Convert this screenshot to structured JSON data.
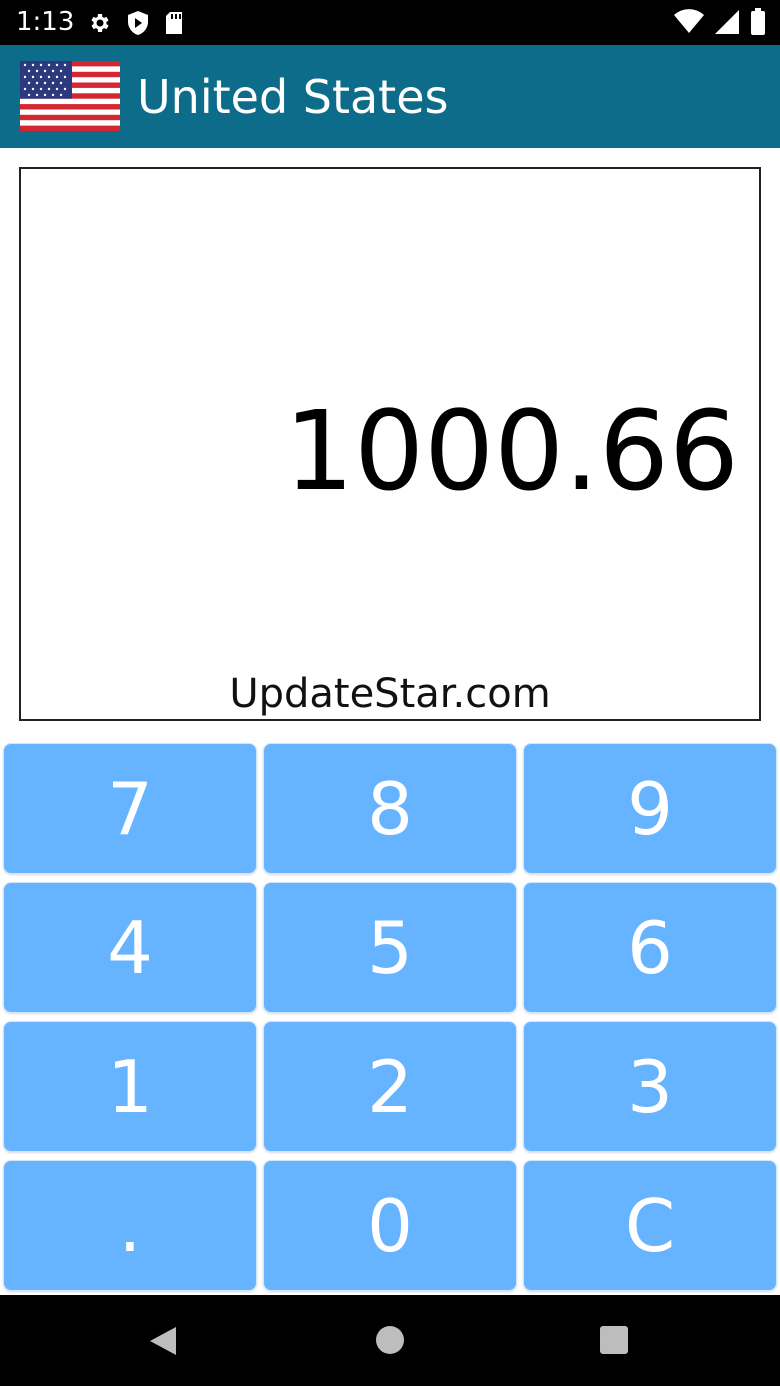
{
  "status_bar": {
    "time": "1:13",
    "left_icons": [
      "gear-icon",
      "shield-play-icon",
      "sd-card-icon"
    ],
    "right_icons": [
      "wifi-icon",
      "signal-icon",
      "battery-icon"
    ]
  },
  "app_bar": {
    "title": "United States",
    "flag": "us-flag-icon"
  },
  "display": {
    "value": "1000.66",
    "watermark": "UpdateStar.com"
  },
  "keypad": {
    "keys": [
      "7",
      "8",
      "9",
      "4",
      "5",
      "6",
      "1",
      "2",
      "3",
      ".",
      "0",
      "C"
    ],
    "key_color": "#66b3ff"
  },
  "nav_bar": {
    "icons": [
      "back-icon",
      "home-icon",
      "recents-icon"
    ]
  },
  "colors": {
    "app_bar": "#0d6c8a",
    "key": "#66b3ff"
  }
}
